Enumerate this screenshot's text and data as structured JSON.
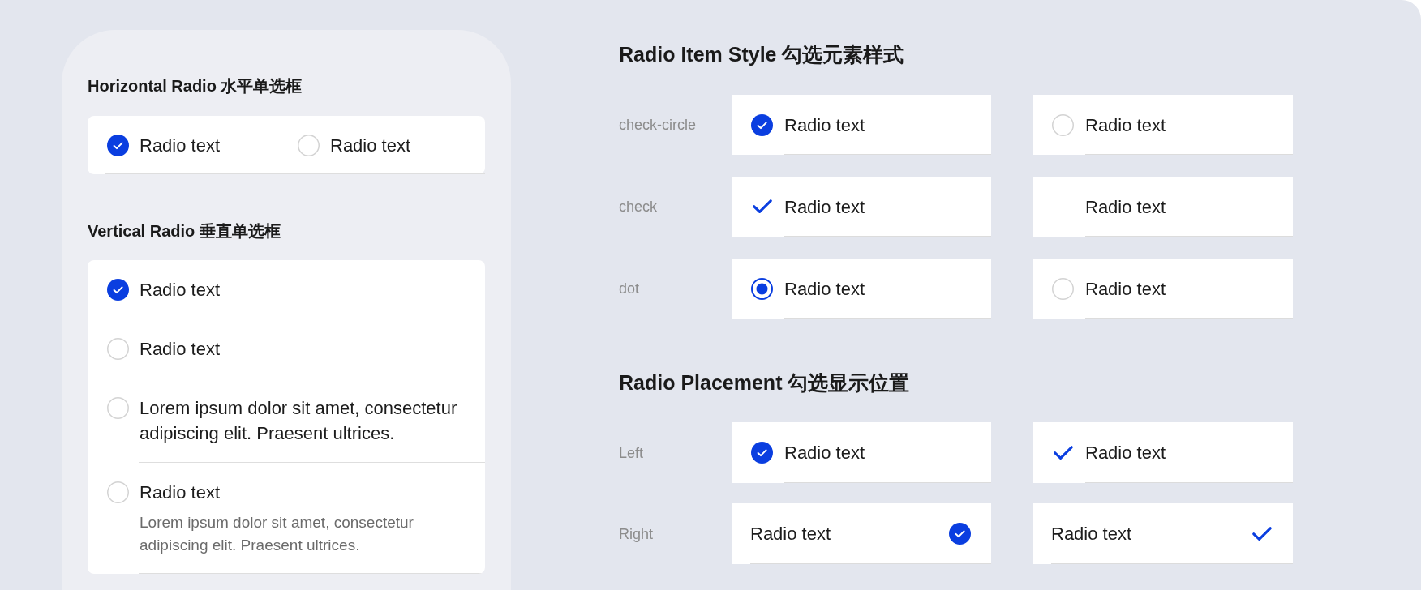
{
  "horizontal_radio": {
    "title": "Horizontal Radio 水平单选框",
    "options": [
      {
        "label": "Radio text",
        "selected": true
      },
      {
        "label": "Radio text",
        "selected": false
      }
    ]
  },
  "vertical_radio": {
    "title": "Vertical Radio 垂直单选框",
    "options": [
      {
        "label": "Radio text",
        "selected": true,
        "divider": true
      },
      {
        "label": "Radio text",
        "selected": false,
        "divider": false
      },
      {
        "label": "Lorem ipsum dolor sit amet, consectetur adipiscing elit. Praesent ultrices.",
        "selected": false,
        "divider": true
      },
      {
        "label": "Radio text",
        "description": "Lorem ipsum dolor sit amet, consectetur adipiscing elit. Praesent ultrices.",
        "selected": false,
        "divider": true
      }
    ]
  },
  "item_style": {
    "title": "Radio Item Style 勾选元素样式",
    "rows": [
      {
        "label": "check-circle",
        "kind": "check-circle",
        "options": [
          {
            "label": "Radio text",
            "selected": true
          },
          {
            "label": "Radio text",
            "selected": false
          }
        ]
      },
      {
        "label": "check",
        "kind": "check",
        "options": [
          {
            "label": "Radio text",
            "selected": true
          },
          {
            "label": "Radio text",
            "selected": false
          }
        ]
      },
      {
        "label": "dot",
        "kind": "dot",
        "options": [
          {
            "label": "Radio text",
            "selected": true
          },
          {
            "label": "Radio text",
            "selected": false
          }
        ]
      }
    ]
  },
  "placement": {
    "title": "Radio Placement 勾选显示位置",
    "rows": [
      {
        "label": "Left",
        "kind": "start",
        "options": [
          {
            "label": "Radio text",
            "selected": true,
            "kind": "check-circle"
          },
          {
            "label": "Radio text",
            "selected": true,
            "kind": "check"
          }
        ]
      },
      {
        "label": "Right",
        "kind": "end",
        "options": [
          {
            "label": "Radio text",
            "selected": true,
            "kind": "check-circle"
          },
          {
            "label": "Radio text",
            "selected": true,
            "kind": "check"
          }
        ]
      }
    ]
  }
}
